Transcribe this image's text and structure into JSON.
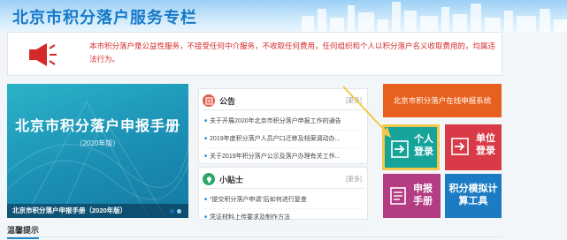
{
  "header": {
    "title": "北京市积分落户服务专栏"
  },
  "notice": {
    "icon": "megaphone-icon",
    "text": "本市积分落户是公益性服务，不接受任何中介服务，不收取任何费用，任何组织和个人以积分落户名义收取费用的，均属违法行为。"
  },
  "banner": {
    "title": "北京市积分落户申报手册",
    "year": "（2020年版）",
    "caption": "北京市积分落户申报手册（2020年版）"
  },
  "announcements": {
    "title": "公告",
    "more": "[更多]",
    "items": [
      "关于开展2020年北京市积分落户申报工作的通告",
      "2019年度积分落户人员户口迁移及档案调动办...",
      "关于2019年积分落户公示及落户办理有关工作..."
    ]
  },
  "tips_panel": {
    "title": "小贴士",
    "more": "[更多]",
    "items": [
      "“提交积分落户申请”后如何进行复查",
      "凭证材料上传要求及制作方法"
    ]
  },
  "tiles": {
    "online": "北京市积分落户在线申报系统",
    "personal": "个人登录",
    "unit": "单位登录",
    "apply": "申报手册",
    "calc": "积分模拟计算工具"
  },
  "footer": {
    "tips_tab": "温馨提示"
  },
  "colors": {
    "orange": "#e8601d",
    "teal": "#16a39a",
    "red": "#d93a47",
    "purple": "#b33c82",
    "blue": "#1c7cc3",
    "highlight": "#f2c94a"
  }
}
